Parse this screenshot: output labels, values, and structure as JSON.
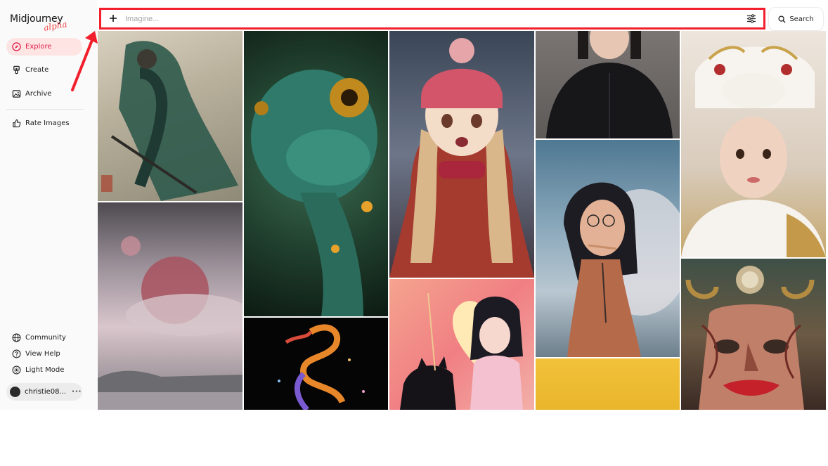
{
  "brand": {
    "name": "Midjourney",
    "tag": "alpha"
  },
  "nav": {
    "explore": "Explore",
    "create": "Create",
    "archive": "Archive",
    "rate": "Rate Images",
    "community": "Community",
    "help": "View Help",
    "light_mode": "Light Mode"
  },
  "user": {
    "name": "christie08...",
    "more": "···"
  },
  "imagine": {
    "placeholder": "Imagine..."
  },
  "search": {
    "label": "Search"
  },
  "colors": {
    "accent": "#e11d48",
    "highlight": "#f21f2c",
    "active_bg": "#ffe4e4"
  },
  "icons": [
    "compass-icon",
    "brush-icon",
    "image-icon",
    "thumbs-up-icon",
    "globe-icon",
    "help-circle-icon",
    "sun-icon",
    "plus-icon",
    "sliders-icon",
    "search-icon"
  ]
}
